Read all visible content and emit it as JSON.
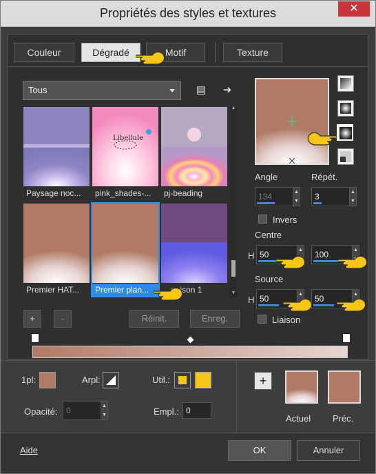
{
  "window": {
    "title": "Propriétés des styles et textures",
    "close_glyph": "✕"
  },
  "tabs": [
    {
      "label": "Couleur"
    },
    {
      "label": "Dégradé"
    },
    {
      "label": "Motif"
    },
    {
      "label": "Texture"
    }
  ],
  "library": {
    "category": "Tous"
  },
  "gradients": [
    {
      "label": "Paysage noc..."
    },
    {
      "label": "pink_shades-..."
    },
    {
      "label": "pj-beading"
    },
    {
      "label": "Premier HAT..."
    },
    {
      "label": "Premier plan..."
    },
    {
      "label": "...poison 1"
    }
  ],
  "thumb_text": {
    "libellule": "Libellule"
  },
  "buttons": {
    "add": "+",
    "remove": "-",
    "reset": "Réinit.",
    "save": "Enreg.",
    "help": "Aide",
    "ok": "OK",
    "cancel": "Annuler",
    "add_color": "+"
  },
  "props": {
    "angle_label": "Angle",
    "angle_value": "134",
    "repeat_label": "Répét.",
    "repeat_value": "3",
    "invert_label": "Invers",
    "center_label": "Centre",
    "center_h": "50",
    "center_v": "100",
    "source_label": "Source",
    "source_h": "50",
    "source_v": "50",
    "link_label": "Liaison",
    "h_label": "H"
  },
  "bottom": {
    "fg_label": "1pl:",
    "arpl_label": "Arpl:",
    "util_label": "Util.:",
    "opacity_label": "Opacité:",
    "opacity_value": "0",
    "empl_label": "Empl.:",
    "empl_value": "0",
    "current_label": "Actuel",
    "prev_label": "Préc."
  },
  "colors": {
    "accent": "#2f8ddf",
    "brown": "#b07a66",
    "gold": "#f5c518"
  }
}
